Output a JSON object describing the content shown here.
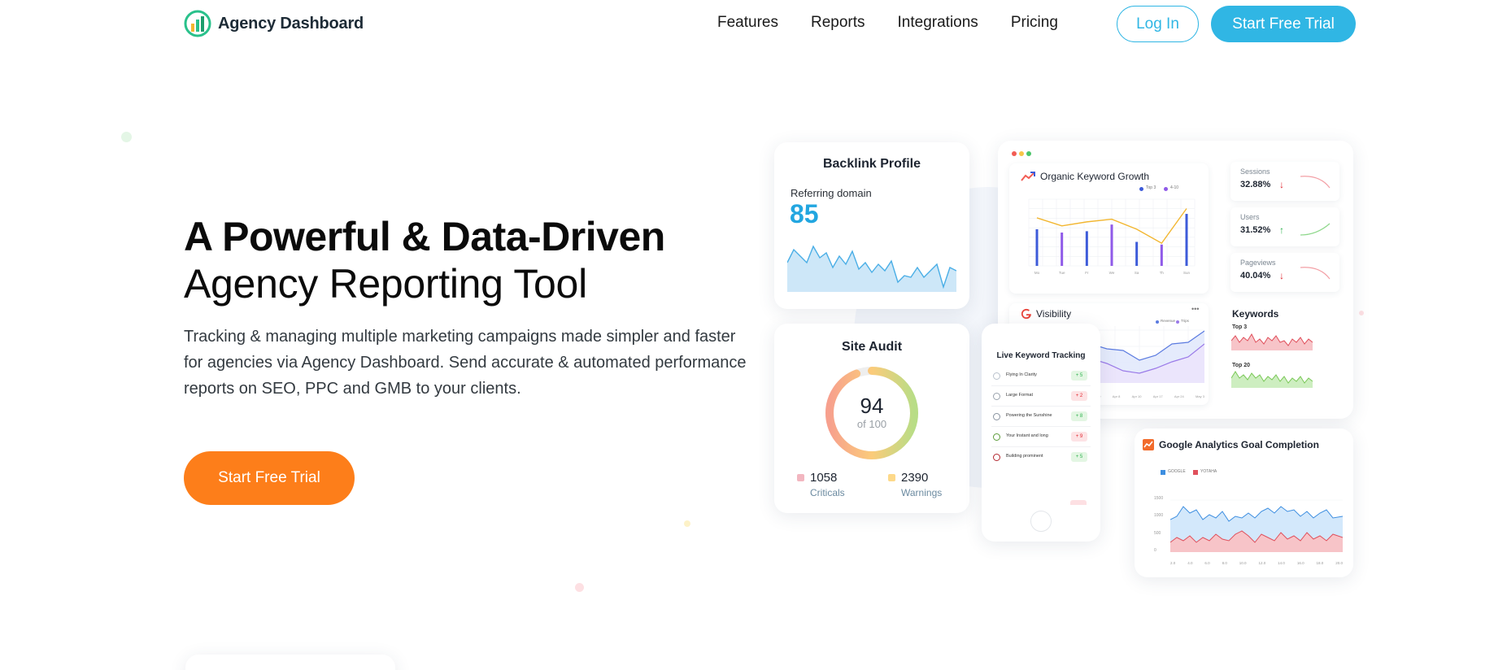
{
  "brand": {
    "name": "Agency Dashboard"
  },
  "nav": {
    "links": [
      "Features",
      "Reports",
      "Integrations",
      "Pricing"
    ],
    "login": "Log In",
    "trial": "Start Free Trial"
  },
  "hero": {
    "title_bold": "A Powerful & Data-Driven",
    "title_light": "Agency Reporting Tool",
    "description": "Tracking & managing multiple marketing campaigns made simpler and faster for agencies via Agency Dashboard. Send accurate & automated performance reports on SEO, PPC and GMB to your clients.",
    "cta": "Start Free Trial"
  },
  "backlink": {
    "title": "Backlink Profile",
    "label": "Referring domain",
    "value": "85"
  },
  "audit": {
    "title": "Site Audit",
    "score": "94",
    "of": "of 100",
    "score_fraction": 0.94,
    "criticals_value": "1058",
    "criticals_label": "Criticals",
    "warnings_value": "2390",
    "warnings_label": "Warnings"
  },
  "organic": {
    "title": "Organic Keyword Growth",
    "legend": [
      "Top 3",
      "4-10"
    ],
    "x_labels": [
      "Mo",
      "Tue",
      "Fr",
      "We",
      "Sa",
      "Th",
      "Sun"
    ]
  },
  "metrics": [
    {
      "label": "Sessions",
      "value": "32.88%",
      "trend": "down"
    },
    {
      "label": "Users",
      "value": "31.52%",
      "trend": "up"
    },
    {
      "label": "Pageviews",
      "value": "40.04%",
      "trend": "down"
    }
  ],
  "visibility": {
    "title": "Visibility",
    "legend": [
      "Revenue",
      "Trips"
    ],
    "x_labels": [
      "Mar 29",
      "Apr 8",
      "Apr 10",
      "Apr 17",
      "Apr 24",
      "May 3"
    ]
  },
  "keywords": {
    "title": "Keywords",
    "top3": "Top 3",
    "top20": "Top 20"
  },
  "live": {
    "title": "Live Keyword Tracking",
    "rows": [
      {
        "name": "Flying In Clarity",
        "change": "+ 5",
        "up": true
      },
      {
        "name": "Large Format",
        "change": "+ 2",
        "up": false
      },
      {
        "name": "Powering the Sunshine",
        "change": "+ 8",
        "up": true
      },
      {
        "name": "Your Instant and long",
        "change": "+ 9",
        "up": false
      },
      {
        "name": "Building prominent",
        "change": "+ 5",
        "up": true
      }
    ]
  },
  "ga": {
    "title": "Google Analytics Goal Completion",
    "legend": [
      "GOOGLE",
      "YOTAHA"
    ],
    "y_labels": [
      "1500",
      "1000",
      "500",
      "0"
    ],
    "x_labels": [
      "2.0",
      "4.0",
      "6.0",
      "8.0",
      "10.0",
      "12.0",
      "14.0",
      "16.0",
      "18.0",
      "20.0"
    ]
  },
  "colors": {
    "accent": "#30b6e4",
    "cta": "#fd7e1a",
    "critical": "#f2b6c0",
    "warning": "#fdd98a",
    "blue_series": "#3d5bd9",
    "purple_series": "#8f5ae8",
    "orange_line": "#f2b630"
  }
}
